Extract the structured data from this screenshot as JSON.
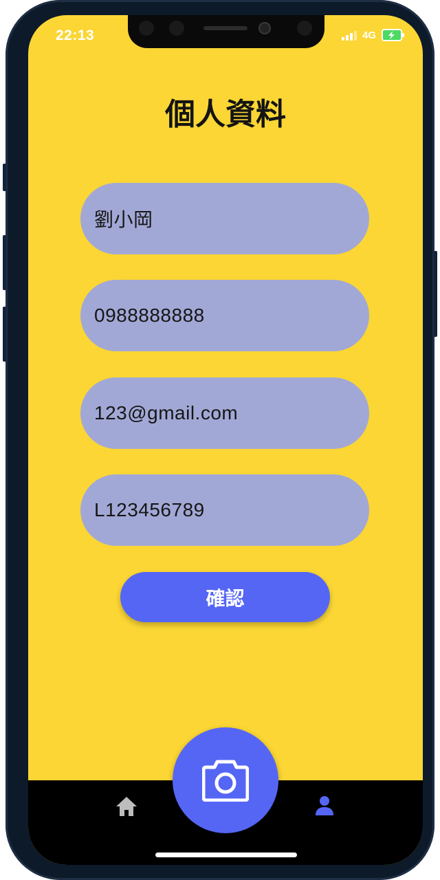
{
  "status_bar": {
    "time": "22:13",
    "network": "4G",
    "battery_charging": true
  },
  "page": {
    "title": "個人資料"
  },
  "form": {
    "fields": [
      {
        "name": "name",
        "value": "劉小岡"
      },
      {
        "name": "phone",
        "value": "0988888888"
      },
      {
        "name": "email",
        "value": "123@gmail.com"
      },
      {
        "name": "id_number",
        "value": "L123456789"
      }
    ],
    "confirm_label": "確認"
  },
  "tab_bar": {
    "items": [
      {
        "icon": "home-icon",
        "active": false
      },
      {
        "icon": "camera-icon",
        "active": false
      },
      {
        "icon": "person-icon",
        "active": true
      }
    ]
  },
  "colors": {
    "background": "#fbd634",
    "field_bg": "#a2a8d6",
    "accent": "#5566f5",
    "tab_bar": "#000000",
    "inactive_icon": "#bdbdbd"
  }
}
